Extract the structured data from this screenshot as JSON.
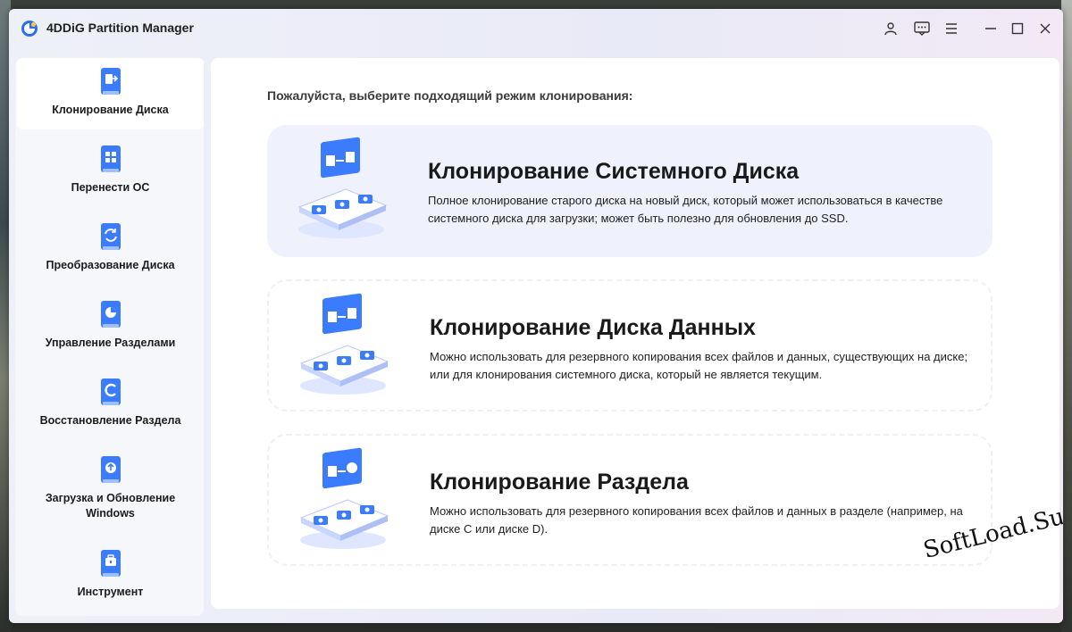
{
  "app": {
    "title": "4DDiG Partition Manager"
  },
  "titlebar": {
    "buttons": [
      "user-icon",
      "feedback-icon",
      "menu-icon",
      "minimize-icon",
      "maximize-icon",
      "close-icon"
    ]
  },
  "sidebar": {
    "items": [
      {
        "label": "Клонирование Диска",
        "icon": "clone-disk-icon",
        "active": true
      },
      {
        "label": "Перенести ОС",
        "icon": "migrate-os-icon",
        "active": false
      },
      {
        "label": "Преобразование Диска",
        "icon": "convert-disk-icon",
        "active": false
      },
      {
        "label": "Управление Разделами",
        "icon": "partition-manage-icon",
        "active": false
      },
      {
        "label": "Восстановление Раздела",
        "icon": "recover-partition-icon",
        "active": false
      },
      {
        "label": "Загрузка и Обновление\nWindows",
        "icon": "boot-update-icon",
        "active": false
      },
      {
        "label": "Инструмент",
        "icon": "toolbox-icon",
        "active": false
      }
    ]
  },
  "main": {
    "prompt": "Пожалуйста, выберите подходящий режим клонирования:",
    "cards": [
      {
        "title": "Клонирование Системного Диска",
        "description": "Полное клонирование старого диска на новый диск, который может использоваться в качестве системного диска для загрузки; может быть полезно для обновления до SSD.",
        "selected": true
      },
      {
        "title": "Клонирование Диска Данных",
        "description": "Можно использовать для резервного копирования всех файлов и данных, существующих на диске; или для клонирования системного диска, который не является текущим.",
        "selected": false
      },
      {
        "title": "Клонирование Раздела",
        "description": "Можно использовать для резервного копирования всех файлов и данных в разделе (например, на диске C или диске D).",
        "selected": false
      }
    ]
  },
  "watermark": "SoftLoad.Su",
  "colors": {
    "accent": "#3b7cff",
    "selected_card": "#eff1fd",
    "sidebar_bg": "#f6f7fb"
  }
}
